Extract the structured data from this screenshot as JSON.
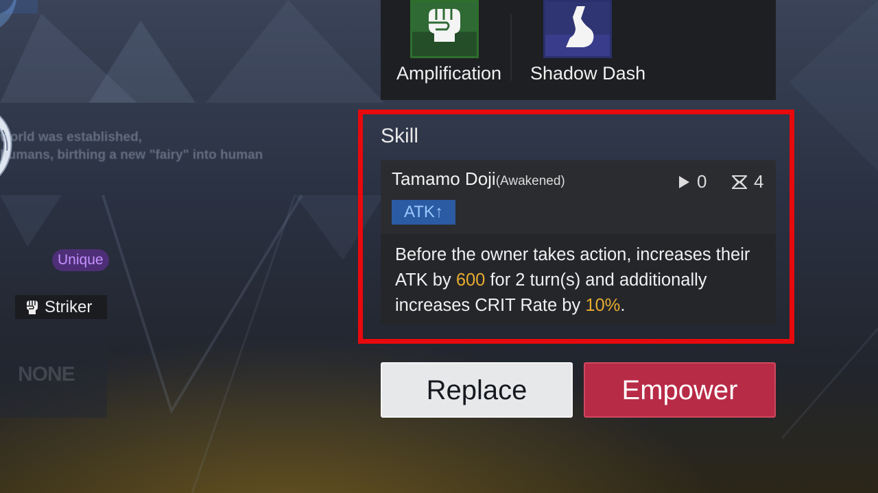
{
  "left_panel": {
    "faded_lines": [
      "world was established,",
      "humans, birthing a new \"fairy\" into human"
    ],
    "unique_badge": "Unique",
    "class_badge": {
      "icon": "fist-icon",
      "label": "Striker"
    },
    "slot_text": "NONE"
  },
  "abilities": [
    {
      "label": "Amplification",
      "icon": "fist-icon",
      "color": "#2f6a34"
    },
    {
      "label": "Shadow Dash",
      "icon": "boot-icon",
      "color": "#2f3572"
    }
  ],
  "skill": {
    "heading": "Skill",
    "name": "Tamamo Doji",
    "name_suffix": "(Awakened)",
    "uses": "0",
    "cooldown": "4",
    "tag": "ATK↑",
    "desc_a": "Before the owner takes action, increases their ATK by ",
    "desc_v1": "600",
    "desc_b": " for 2 turn(s) and additionally increases CRIT Rate by ",
    "desc_v2": "10%",
    "desc_c": "."
  },
  "buttons": {
    "replace": "Replace",
    "empower": "Empower"
  },
  "colors": {
    "highlight": "#e8090d",
    "accent_value": "#e6ab2f",
    "empower": "#b82b47",
    "tag": "#2b5ba3"
  }
}
